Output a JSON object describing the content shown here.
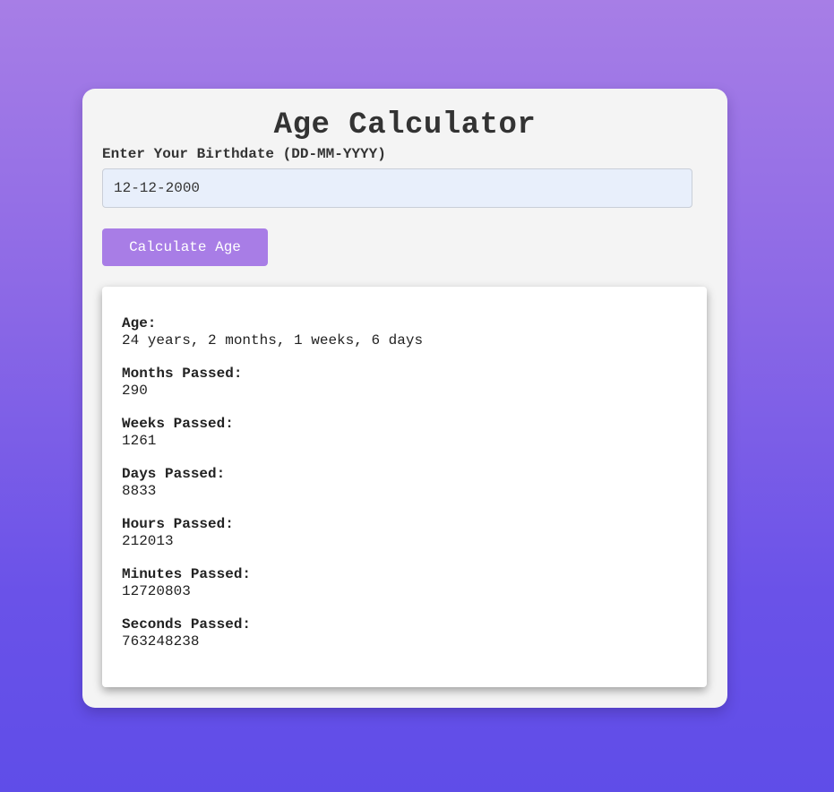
{
  "title": "Age Calculator",
  "form": {
    "label": "Enter Your Birthdate (DD-MM-YYYY)",
    "value": "12-12-2000",
    "button_label": "Calculate Age"
  },
  "results": [
    {
      "label": "Age:",
      "value": "24 years, 2 months, 1 weeks, 6 days"
    },
    {
      "label": "Months Passed:",
      "value": "290"
    },
    {
      "label": "Weeks Passed:",
      "value": "1261"
    },
    {
      "label": "Days Passed:",
      "value": "8833"
    },
    {
      "label": "Hours Passed:",
      "value": "212013"
    },
    {
      "label": "Minutes Passed:",
      "value": "12720803"
    },
    {
      "label": "Seconds Passed:",
      "value": "763248238"
    }
  ],
  "colors": {
    "accent": "#a87de6",
    "background_top": "#a77ee6",
    "background_bottom": "#5f4de8",
    "card": "#f4f4f4",
    "input_bg": "#e8effb"
  }
}
